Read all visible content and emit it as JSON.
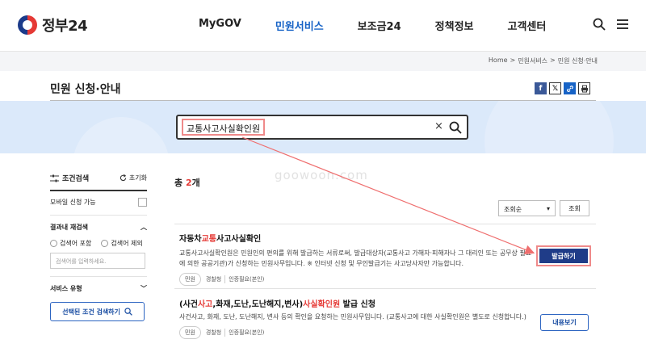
{
  "header": {
    "logo_text": "정부24",
    "nav": [
      "MyGOV",
      "민원서비스",
      "보조금24",
      "정책정보",
      "고객센터"
    ],
    "active_nav": "민원서비스"
  },
  "breadcrumb": [
    "Home",
    ">",
    "민원서비스",
    ">",
    "민원 신청·안내"
  ],
  "page_title": "민원 신청·안내",
  "share": {
    "facebook": "f",
    "x": "𝕏"
  },
  "search": {
    "query": "교통사고사실확인원",
    "clear": "×"
  },
  "watermark": "goowoon.com",
  "sidebar": {
    "title": "조건검색",
    "reset": "초기화",
    "mobile_label": "모바일 신청 가능",
    "refine_title": "결과내 재검색",
    "include_label": "검색어 포함",
    "exclude_label": "검색어 제외",
    "input_placeholder": "검색어를 입력하세요.",
    "service_type": "서비스 유형",
    "search_button": "선택된 조건 검색하기"
  },
  "results": {
    "count_prefix": "총 ",
    "count": "2",
    "count_suffix": "개",
    "sort_value": "조회순",
    "lookup_button": "조회",
    "items": [
      {
        "title_a": "자동차",
        "title_hl": "교통",
        "title_b": "사고사실확인",
        "desc": "교통사고사실확인원은 민원인의 편의를 위해 발급하는 서류로써, 발급대상자(교통사고 가해자·피해자나 그 대리인 또는 공무상 필요에 의한 공공기관)가 신청하는 민원사무입니다. ※ 인터넷 신청 및 무인발급기는 사고당사자만 가능합니다.",
        "tag1": "민원",
        "tag2": "경찰청",
        "tag3": "인증필요(본인)",
        "button": "발급하기"
      },
      {
        "title_a": "(사건",
        "title_hl1": "사고",
        "title_b": ",화재,도난,도난해지,변사)",
        "title_hl2": "사실확인원",
        "title_c": " 발급 신청",
        "desc": "사건사고, 화재, 도난, 도난해지, 변사 등의 확인을 요청하는 민원사무입니다. (교통사고에 대한 사실확인원은 별도로 신청합니다.)",
        "tag1": "민원",
        "tag2": "경찰청",
        "tag3": "인증필요(본인)",
        "button": "내용보기"
      }
    ]
  },
  "colors": {
    "accent_blue": "#1763c6",
    "navy_button": "#1f3c88",
    "highlight_red": "#e53935",
    "annotation_pink": "#ef8a8a",
    "band_blue": "#dbe9fa"
  }
}
